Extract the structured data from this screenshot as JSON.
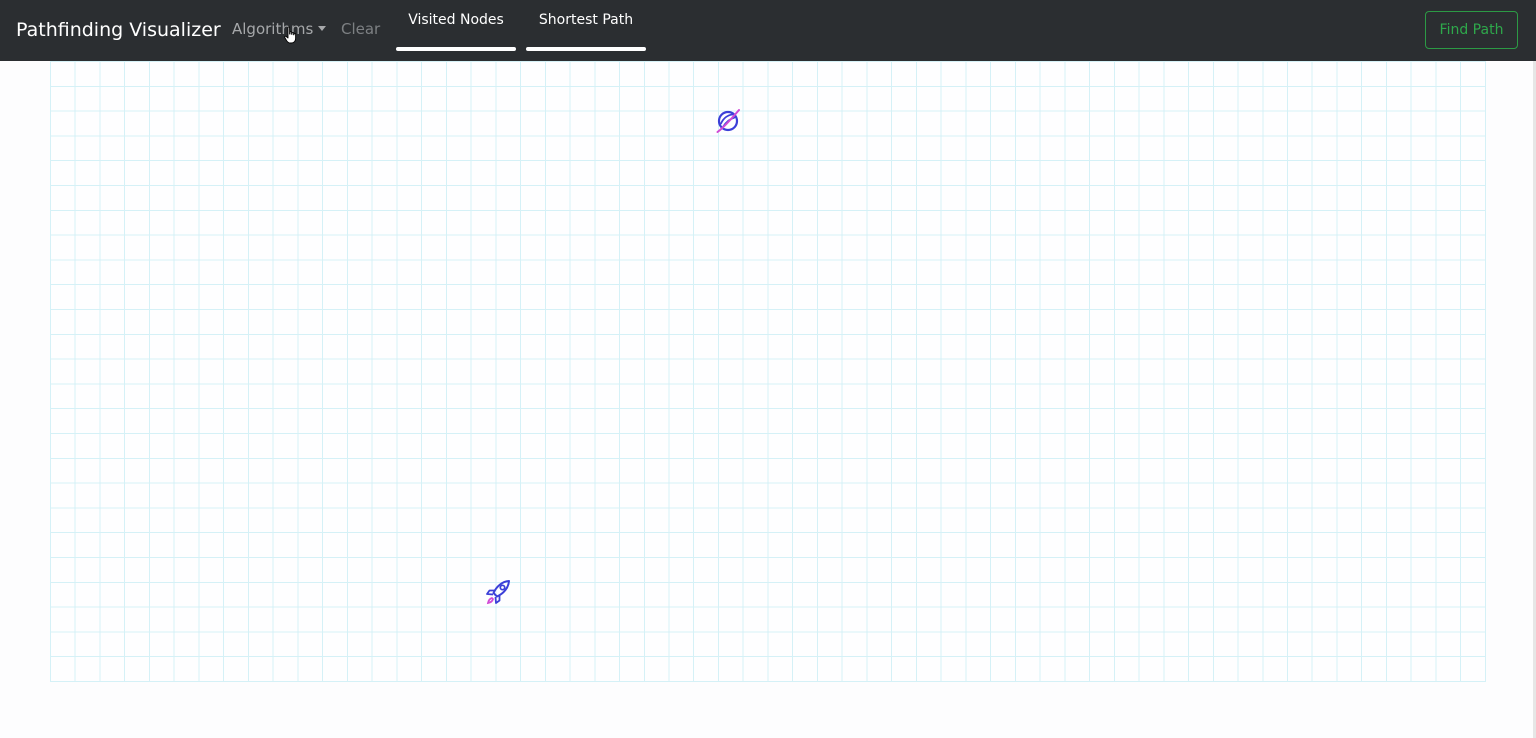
{
  "navbar": {
    "brand": "Pathfinding Visualizer",
    "algorithms_label": "Algorithms",
    "clear_label": "Clear",
    "find_path_label": "Find Path"
  },
  "legend": {
    "visited_label": "Visited Nodes",
    "shortest_label": "Shortest Path"
  },
  "grid": {
    "start_icon": "rocket-icon",
    "target_icon": "planet-icon"
  },
  "colors": {
    "navbar_bg": "#2b2e31",
    "grid_line": "#d5f1f7",
    "find_path": "#2ea84b",
    "icon_blue": "#3b3fd8",
    "icon_pink": "#d14ad6"
  }
}
